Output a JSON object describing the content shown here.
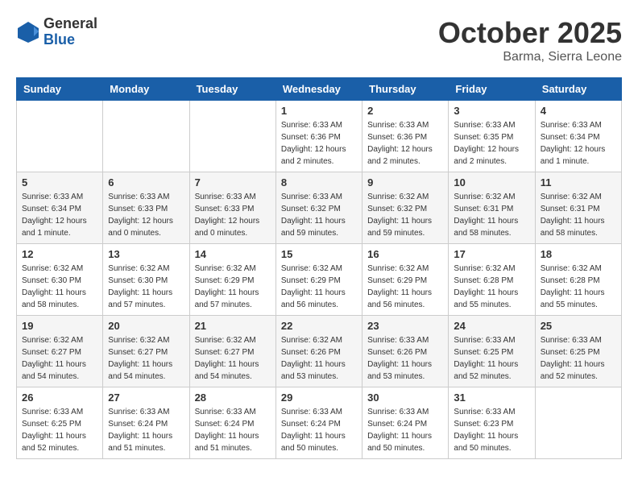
{
  "logo": {
    "general": "General",
    "blue": "Blue"
  },
  "title": "October 2025",
  "location": "Barma, Sierra Leone",
  "weekdays": [
    "Sunday",
    "Monday",
    "Tuesday",
    "Wednesday",
    "Thursday",
    "Friday",
    "Saturday"
  ],
  "weeks": [
    [
      {
        "day": "",
        "info": ""
      },
      {
        "day": "",
        "info": ""
      },
      {
        "day": "",
        "info": ""
      },
      {
        "day": "1",
        "info": "Sunrise: 6:33 AM\nSunset: 6:36 PM\nDaylight: 12 hours\nand 2 minutes."
      },
      {
        "day": "2",
        "info": "Sunrise: 6:33 AM\nSunset: 6:36 PM\nDaylight: 12 hours\nand 2 minutes."
      },
      {
        "day": "3",
        "info": "Sunrise: 6:33 AM\nSunset: 6:35 PM\nDaylight: 12 hours\nand 2 minutes."
      },
      {
        "day": "4",
        "info": "Sunrise: 6:33 AM\nSunset: 6:34 PM\nDaylight: 12 hours\nand 1 minute."
      }
    ],
    [
      {
        "day": "5",
        "info": "Sunrise: 6:33 AM\nSunset: 6:34 PM\nDaylight: 12 hours\nand 1 minute."
      },
      {
        "day": "6",
        "info": "Sunrise: 6:33 AM\nSunset: 6:33 PM\nDaylight: 12 hours\nand 0 minutes."
      },
      {
        "day": "7",
        "info": "Sunrise: 6:33 AM\nSunset: 6:33 PM\nDaylight: 12 hours\nand 0 minutes."
      },
      {
        "day": "8",
        "info": "Sunrise: 6:33 AM\nSunset: 6:32 PM\nDaylight: 11 hours\nand 59 minutes."
      },
      {
        "day": "9",
        "info": "Sunrise: 6:32 AM\nSunset: 6:32 PM\nDaylight: 11 hours\nand 59 minutes."
      },
      {
        "day": "10",
        "info": "Sunrise: 6:32 AM\nSunset: 6:31 PM\nDaylight: 11 hours\nand 58 minutes."
      },
      {
        "day": "11",
        "info": "Sunrise: 6:32 AM\nSunset: 6:31 PM\nDaylight: 11 hours\nand 58 minutes."
      }
    ],
    [
      {
        "day": "12",
        "info": "Sunrise: 6:32 AM\nSunset: 6:30 PM\nDaylight: 11 hours\nand 58 minutes."
      },
      {
        "day": "13",
        "info": "Sunrise: 6:32 AM\nSunset: 6:30 PM\nDaylight: 11 hours\nand 57 minutes."
      },
      {
        "day": "14",
        "info": "Sunrise: 6:32 AM\nSunset: 6:29 PM\nDaylight: 11 hours\nand 57 minutes."
      },
      {
        "day": "15",
        "info": "Sunrise: 6:32 AM\nSunset: 6:29 PM\nDaylight: 11 hours\nand 56 minutes."
      },
      {
        "day": "16",
        "info": "Sunrise: 6:32 AM\nSunset: 6:29 PM\nDaylight: 11 hours\nand 56 minutes."
      },
      {
        "day": "17",
        "info": "Sunrise: 6:32 AM\nSunset: 6:28 PM\nDaylight: 11 hours\nand 55 minutes."
      },
      {
        "day": "18",
        "info": "Sunrise: 6:32 AM\nSunset: 6:28 PM\nDaylight: 11 hours\nand 55 minutes."
      }
    ],
    [
      {
        "day": "19",
        "info": "Sunrise: 6:32 AM\nSunset: 6:27 PM\nDaylight: 11 hours\nand 54 minutes."
      },
      {
        "day": "20",
        "info": "Sunrise: 6:32 AM\nSunset: 6:27 PM\nDaylight: 11 hours\nand 54 minutes."
      },
      {
        "day": "21",
        "info": "Sunrise: 6:32 AM\nSunset: 6:27 PM\nDaylight: 11 hours\nand 54 minutes."
      },
      {
        "day": "22",
        "info": "Sunrise: 6:32 AM\nSunset: 6:26 PM\nDaylight: 11 hours\nand 53 minutes."
      },
      {
        "day": "23",
        "info": "Sunrise: 6:33 AM\nSunset: 6:26 PM\nDaylight: 11 hours\nand 53 minutes."
      },
      {
        "day": "24",
        "info": "Sunrise: 6:33 AM\nSunset: 6:25 PM\nDaylight: 11 hours\nand 52 minutes."
      },
      {
        "day": "25",
        "info": "Sunrise: 6:33 AM\nSunset: 6:25 PM\nDaylight: 11 hours\nand 52 minutes."
      }
    ],
    [
      {
        "day": "26",
        "info": "Sunrise: 6:33 AM\nSunset: 6:25 PM\nDaylight: 11 hours\nand 52 minutes."
      },
      {
        "day": "27",
        "info": "Sunrise: 6:33 AM\nSunset: 6:24 PM\nDaylight: 11 hours\nand 51 minutes."
      },
      {
        "day": "28",
        "info": "Sunrise: 6:33 AM\nSunset: 6:24 PM\nDaylight: 11 hours\nand 51 minutes."
      },
      {
        "day": "29",
        "info": "Sunrise: 6:33 AM\nSunset: 6:24 PM\nDaylight: 11 hours\nand 50 minutes."
      },
      {
        "day": "30",
        "info": "Sunrise: 6:33 AM\nSunset: 6:24 PM\nDaylight: 11 hours\nand 50 minutes."
      },
      {
        "day": "31",
        "info": "Sunrise: 6:33 AM\nSunset: 6:23 PM\nDaylight: 11 hours\nand 50 minutes."
      },
      {
        "day": "",
        "info": ""
      }
    ]
  ]
}
